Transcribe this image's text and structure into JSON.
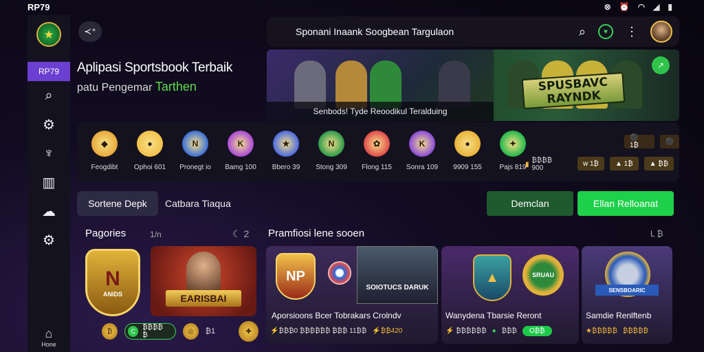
{
  "status": {
    "brand": "RP79"
  },
  "sidebar": {
    "brand_label": "RP79",
    "home_label": "Hone"
  },
  "back_button": {
    "label": "≺⁺"
  },
  "headline": {
    "line1": "Aplipasi Sportsbook Terbaik",
    "line2_prefix": "patu Pengemar",
    "line2_accent": "Tarthen"
  },
  "search": {
    "title": "Sponani Inaank Soogbean Targulaon"
  },
  "banner": {
    "caption": "Senbods! Tyde Reoodikul Teralduing",
    "promo_title_1": "SPUSBAVC",
    "promo_title_2": "RAYNDK"
  },
  "categories": [
    {
      "label": "Feogdibt",
      "color": "#e8a93a",
      "glyph": "◆"
    },
    {
      "label": "Ophoi 601",
      "color": "#f2c14a",
      "glyph": "●"
    },
    {
      "label": "Pronegt io",
      "color": "#3b6fd8",
      "glyph": "N"
    },
    {
      "label": "Bamg 100",
      "color": "#a94ad8",
      "glyph": "K"
    },
    {
      "label": "Bbero 39",
      "color": "#4a6ae0",
      "glyph": "★"
    },
    {
      "label": "Stong 309",
      "color": "#2e9a4a",
      "glyph": "N"
    },
    {
      "label": "Flong 115",
      "color": "#e04a4a",
      "glyph": "✿"
    },
    {
      "label": "Sonra 109",
      "color": "#8a4ad8",
      "glyph": "K"
    },
    {
      "label": "9909 155",
      "color": "#e8b23a",
      "glyph": "●"
    },
    {
      "label": "Pajs 819",
      "color": "#22b84a",
      "glyph": "✦"
    }
  ],
  "cat_meta": {
    "line1": "₿₿₿₿",
    "line2": "900"
  },
  "cat_pills": [
    {
      "text": "ᴡ 1₿",
      "color": "#4a3a1a"
    },
    {
      "text": "▲ 1₿",
      "color": "#4a3a1a"
    },
    {
      "text": "▲ ₿₿",
      "color": "#4a3a1a"
    }
  ],
  "cat_pills_top": [
    {
      "text": "⚫ 1₿",
      "color": "#3a2a18"
    },
    {
      "text": "⚫",
      "color": "#3a2a18"
    }
  ],
  "filters": {
    "tab_active": "Sortene Depk",
    "tab_plain": "Catbara Tiaqua",
    "btn_dark": "Demclan",
    "btn_bright": "Ellan Relloanat"
  },
  "left_section": {
    "title": "Pagories",
    "meta_left": "1/n",
    "meta_right": "☾ 2",
    "hero_label": "EARISBAI",
    "badge_letters": "N",
    "badge_text": "ANIDS"
  },
  "right_section": {
    "title": "Pramfiosi lene sooen",
    "meta_right": "L ₿"
  },
  "cards": [
    {
      "title": "Aporsioons Bcer Tobrakars Crolndv",
      "stats": "⚡₿₿₿0 ₿₿₿₿₿₿ ₿₿₿ 11₿₿",
      "stat_gold": "⚡₿₿420",
      "badge_a": "NP",
      "label_b": "SOIOTUCS DARUK"
    },
    {
      "title": "Wanydena Tbarsie Reront",
      "stats": "⚡ ₿₿₿₿₿₿",
      "stat_num": "₿₿₿",
      "pill": "O₿₿",
      "badge_a": "▲",
      "label_b": "SRUAU"
    },
    {
      "title": "Samdie Renlftenb",
      "stats": "★₿₿₿₿₿",
      "stat_gold": "₿₿₿₿₿",
      "label_b": "SENSBOARIC"
    }
  ],
  "bottom_strip": {
    "toggle_label": "₿₿₿₿₿",
    "score": "₿1"
  }
}
